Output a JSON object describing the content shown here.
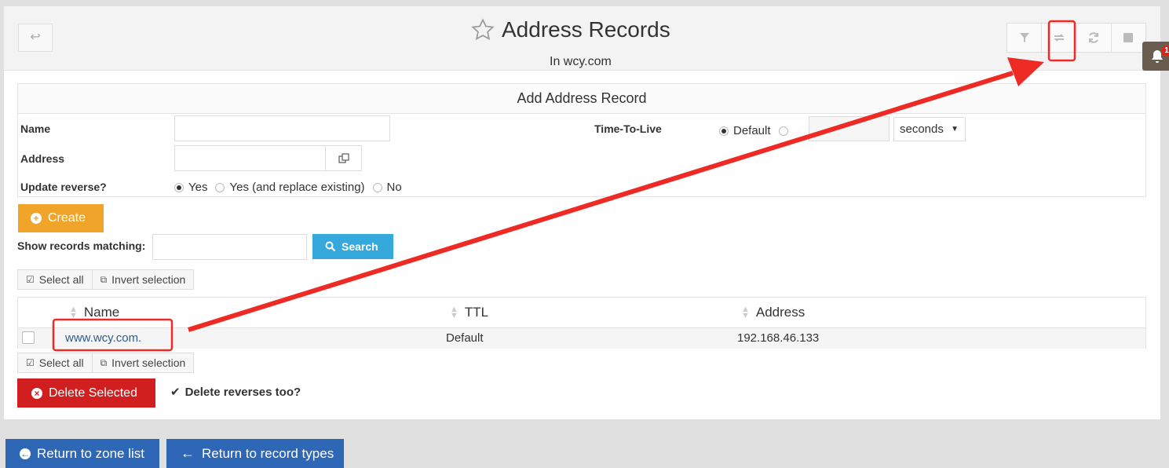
{
  "header": {
    "title": "Address Records",
    "subtitle": "In wcy.com",
    "back_icon": "↩",
    "notification_count": "1"
  },
  "form": {
    "heading": "Add Address Record",
    "name_label": "Name",
    "name_value": "",
    "address_label": "Address",
    "address_value": "",
    "ttl_label": "Time-To-Live",
    "ttl_default_label": "Default",
    "ttl_unit": "seconds",
    "update_reverse_label": "Update reverse?",
    "reverse_options": [
      "Yes",
      "Yes (and replace existing)",
      "No"
    ],
    "create_label": "Create"
  },
  "search": {
    "label": "Show records matching:",
    "value": "",
    "button_label": "Search"
  },
  "selection": {
    "select_all": "Select all",
    "invert": "Invert selection"
  },
  "table": {
    "columns": [
      "Name",
      "TTL",
      "Address"
    ],
    "rows": [
      {
        "name": "www.wcy.com.",
        "ttl": "Default",
        "address": "192.168.46.133"
      }
    ]
  },
  "actions": {
    "delete_label": "Delete Selected",
    "delete_reverses_label": "Delete reverses too?",
    "return_zone_label": "Return to zone list",
    "return_types_label": "Return to record types"
  },
  "colors": {
    "annotation_red": "#ee2a24",
    "create_orange": "#f0a42a",
    "search_blue": "#35a9dc",
    "delete_red": "#d11f1f",
    "nav_blue": "#2f67b7"
  }
}
